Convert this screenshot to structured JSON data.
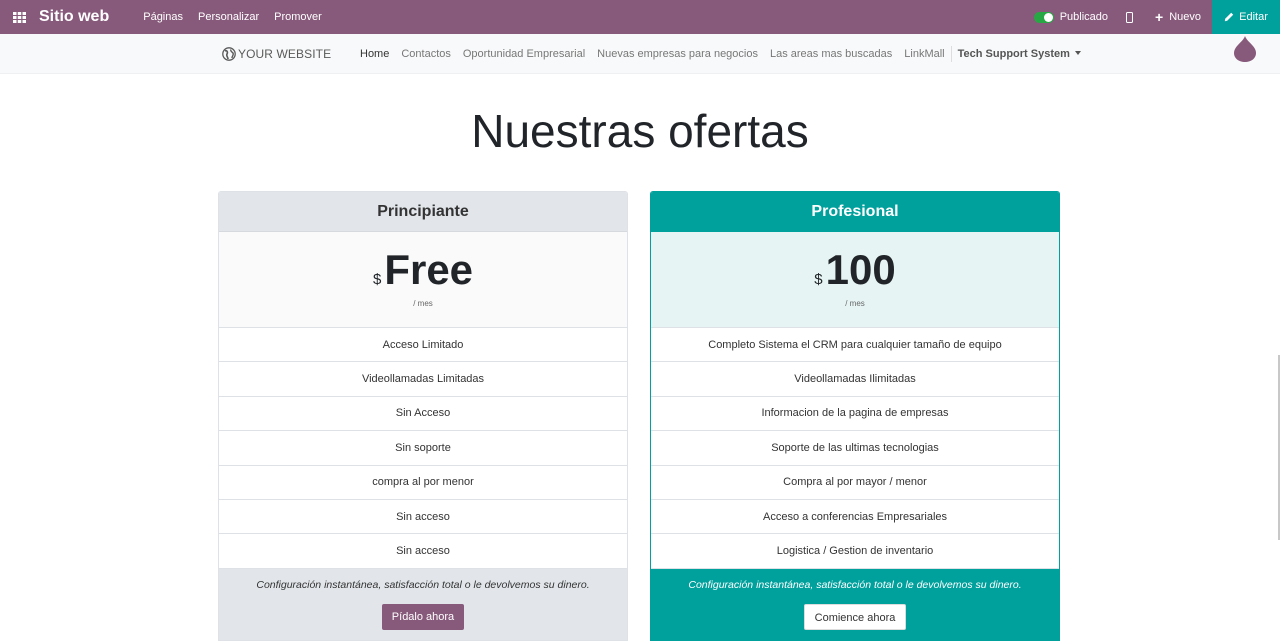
{
  "topbar": {
    "app_title": "Sitio web",
    "menu": [
      "Páginas",
      "Personalizar",
      "Promover"
    ],
    "published_label": "Publicado",
    "new_label": "Nuevo",
    "edit_label": "Editar",
    "bar_color": "#875a7b",
    "edit_color": "#00a09d"
  },
  "sitenav": {
    "logo_text": "YOUR WEBSITE",
    "links": [
      "Home",
      "Contactos",
      "Oportunidad Empresarial",
      "Nuevas empresas para negocios",
      "Las areas mas buscadas",
      "LinkMall"
    ],
    "dropdown_label": "Tech Support System"
  },
  "page": {
    "heading": "Nuestras ofertas"
  },
  "plans": [
    {
      "name": "Principiante",
      "currency": "$",
      "price": "Free",
      "period": "/ mes",
      "features": [
        "Acceso Limitado",
        "Videollamadas Limitadas",
        "Sin Acceso",
        "Sin soporte",
        "compra al por menor",
        "Sin acceso",
        "Sin acceso"
      ],
      "note": "Configuración instantánea, satisfacción total o le devolvemos su dinero.",
      "button": "Pídalo ahora"
    },
    {
      "name": "Profesional",
      "currency": "$",
      "price": "100",
      "period": "/ mes",
      "features": [
        "Completo Sistema el CRM para cualquier tamaño de equipo",
        "Videollamadas Ilimitadas",
        "Informacion de la pagina de empresas",
        "Soporte de las ultimas tecnologias",
        "Compra al por mayor / menor",
        "Acceso a conferencias Empresariales",
        "Logistica / Gestion de inventario"
      ],
      "note": "Configuración instantánea, satisfacción total o le devolvemos su dinero.",
      "button": "Comience ahora"
    }
  ]
}
